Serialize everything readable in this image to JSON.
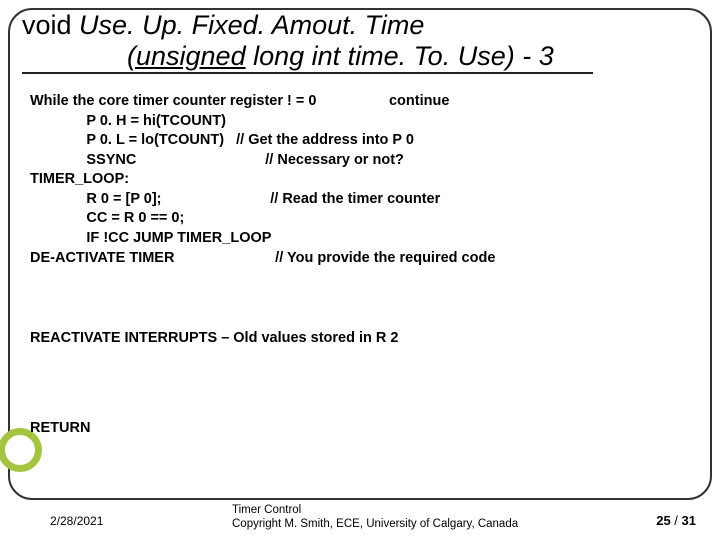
{
  "title": {
    "line1_prefix": "void ",
    "line1_italic": "Use. Up. Fixed. Amout. Time",
    "line2_kw": "(unsigned",
    "line2_rest": " long int time. To. Use) - 3"
  },
  "code": {
    "l1a": "While the core timer counter register ! = 0",
    "l1b": "continue",
    "l2": "              P 0. H = hi(TCOUNT)",
    "l3": "              P 0. L = lo(TCOUNT)   // Get the address into P 0",
    "l4": "              SSYNC                                // Necessary or not?",
    "l5": "TIMER_LOOP:",
    "l6": "              R 0 = [P 0];                           // Read the timer counter",
    "l7": "              CC = R 0 == 0;",
    "l8": "              IF !CC JUMP TIMER_LOOP",
    "l9": "DE-ACTIVATE TIMER                         // You provide the required code"
  },
  "para2": "REACTIVATE INTERRUPTS – Old values stored in R 2",
  "para3": "RETURN",
  "footer": {
    "date": "2/28/2021",
    "center_l1": "Timer Control",
    "center_l2": "Copyright M. Smith, ECE, University of Calgary, Canada",
    "page_cur": "25",
    "page_sep": " / ",
    "page_total": "31"
  }
}
